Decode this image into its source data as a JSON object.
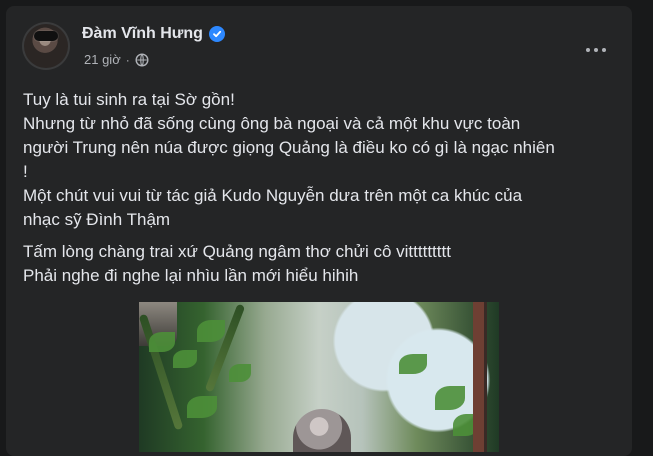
{
  "post": {
    "author_name": "Đàm Vĩnh Hưng",
    "timestamp": "21 giờ",
    "separator": "·",
    "privacy_icon": "globe-icon",
    "verified_icon": "verified-badge-icon",
    "more_icon": "more-options-icon",
    "text_lines": [
      "Tuy là tui sinh ra tại Sờ gồn!",
      "Nhưng từ nhỏ đã sống cùng ông bà ngoại và cả một khu vực toàn",
      "người Trung nên núa được giọng Quảng là điều ko có gì là ngạc nhiên",
      "!",
      "Một chút vui vui từ tác giả Kudo Nguyễn dưa trên một ca khúc của",
      "nhạc sỹ Đình Thậm",
      "Tấm lòng chàng trai xứ Quảng ngâm thơ chửi cô vittttttttt",
      "Phải nghe đi nghe lại nhìu lần mới hiểu hihih"
    ]
  },
  "colors": {
    "page_background": "#18191a",
    "card_background": "#242526",
    "primary_text": "#e4e6eb",
    "secondary_text": "#b0b3b8",
    "verified_blue": "#2d88ff"
  }
}
